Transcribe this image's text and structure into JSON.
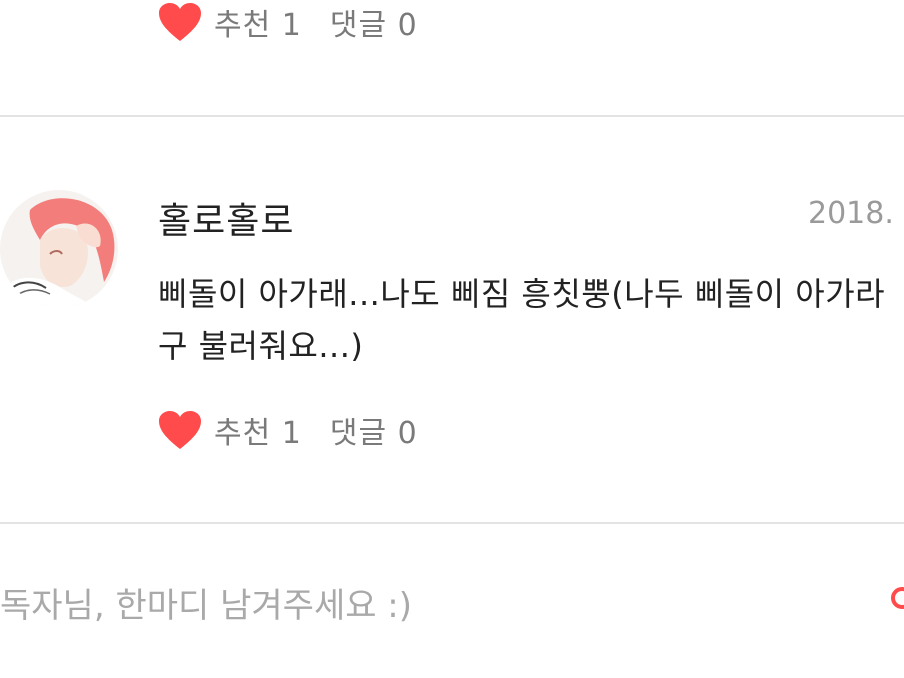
{
  "colors": {
    "heart": "#ff4b4b",
    "submit_accent": "#ff4b4b"
  },
  "top_comment": {
    "recommend_label": "추천",
    "recommend_count": "1",
    "reply_label": "댓글",
    "reply_count": "0"
  },
  "comment": {
    "author": "홀로홀로",
    "date": "2018.",
    "text": "삐돌이 아가래...나도 삐짐 흥칫뿡(나두 삐돌이 아가라구 불러줘요...)",
    "recommend_label": "추천",
    "recommend_count": "1",
    "reply_label": "댓글",
    "reply_count": "0"
  },
  "input": {
    "placeholder": "독자님, 한마디 남겨주세요 :)",
    "value": ""
  }
}
